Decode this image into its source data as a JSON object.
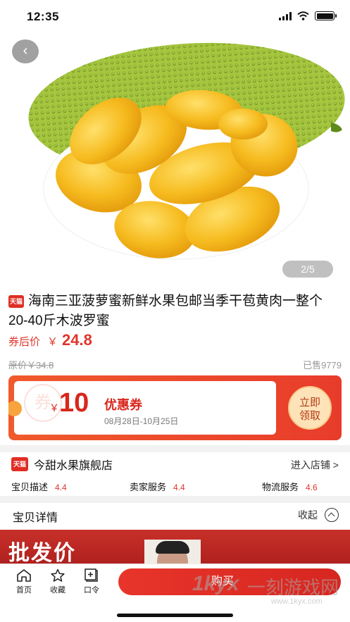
{
  "status": {
    "time": "12:35"
  },
  "hero": {
    "page_indicator": "2/5"
  },
  "product": {
    "badge": "天猫",
    "title": "海南三亚菠萝蜜新鲜水果包邮当季干苞黄肉一整个20-40斤木波罗蜜",
    "price_label": "券后价",
    "currency": "￥",
    "price": "24.8",
    "original_price": "原价￥34.8",
    "sold": "已售9779"
  },
  "coupon": {
    "watermark": "券",
    "currency": "￥",
    "amount": "10",
    "name": "优惠券",
    "dates": "08月28日-10月25日",
    "claim_line1": "立即",
    "claim_line2": "领取"
  },
  "shop": {
    "badge": "天猫",
    "name": "今甜水果旗舰店",
    "enter_label": "进入店铺 >",
    "ratings": [
      {
        "label": "宝贝描述",
        "value": "4.4"
      },
      {
        "label": "卖家服务",
        "value": "4.4"
      },
      {
        "label": "物流服务",
        "value": "4.6"
      }
    ]
  },
  "details": {
    "title": "宝贝详情",
    "collapse_label": "收起",
    "banner_text": "批发价"
  },
  "bottom_nav": {
    "home": "首页",
    "favorite": "收藏",
    "command": "口令",
    "buy": "购买"
  },
  "watermark": {
    "logo": "1kyx",
    "name": "一刻游戏网",
    "url": "www.1kyx.com"
  },
  "colors": {
    "accent": "#e0342a",
    "coupon_bg": "#f05a2c",
    "jackfruit_green": "#9fc43a",
    "flesh_yellow": "#f5b91c"
  }
}
